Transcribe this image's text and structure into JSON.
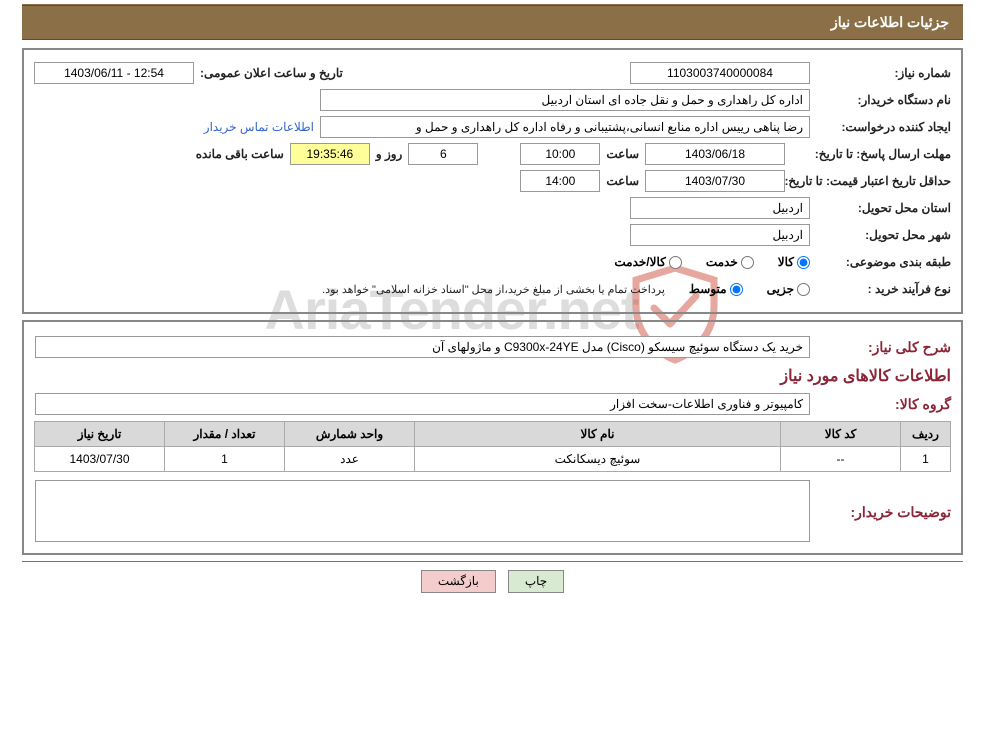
{
  "title": "جزئیات اطلاعات نیاز",
  "watermark": "AriaTender.net",
  "panel1": {
    "req_no_label": "شماره نیاز:",
    "req_no": "1103003740000084",
    "announce_label": "تاریخ و ساعت اعلان عمومی:",
    "announce_value": "12:54 - 1403/06/11",
    "buyer_org_label": "نام دستگاه خریدار:",
    "buyer_org": "اداره کل راهداری و حمل و نقل جاده ای استان اردبیل",
    "requester_label": "ایجاد کننده درخواست:",
    "requester": "رضا پناهی رییس اداره منابع انسانی،پشتیبانی و رفاه اداره کل راهداری و حمل و",
    "buyer_contact_link": "اطلاعات تماس خریدار",
    "deadline_label": "مهلت ارسال پاسخ:    تا تاریخ:",
    "deadline_date": "1403/06/18",
    "time_label": "ساعت",
    "deadline_time": "10:00",
    "days_value": "6",
    "days_and": "روز و",
    "countdown": "19:35:46",
    "remaining_label": "ساعت باقی مانده",
    "validity_label": "حداقل تاریخ اعتبار قیمت: تا تاریخ:",
    "validity_date": "1403/07/30",
    "validity_time": "14:00",
    "province_label": "استان محل تحویل:",
    "province": "اردبیل",
    "city_label": "شهر محل تحویل:",
    "city": "اردبیل",
    "category_label": "طبقه بندی موضوعی:",
    "cat_goods": "کالا",
    "cat_service": "خدمت",
    "cat_goods_service": "کالا/خدمت",
    "process_label": "نوع فرآیند خرید :",
    "process_partial": "جزیی",
    "process_medium": "متوسط",
    "process_note": "پرداخت تمام یا بخشی از مبلغ خرید،از محل \"اسناد خزانه اسلامی\" خواهد بود."
  },
  "panel2": {
    "desc_label": "شرح کلی نیاز:",
    "desc_value": "خرید یک دستگاه سوئیچ سیسکو (Cisco) مدل C9300x-24YE و ماژولهای آن",
    "items_title": "اطلاعات کالاهای مورد نیاز",
    "group_label": "گروه کالا:",
    "group_value": "کامپیوتر و فناوری اطلاعات-سخت افزار",
    "table": {
      "headers": [
        "ردیف",
        "کد کالا",
        "نام کالا",
        "واحد شمارش",
        "تعداد / مقدار",
        "تاریخ نیاز"
      ],
      "rows": [
        {
          "idx": "1",
          "code": "--",
          "name": "سوئیچ دیسکانکت",
          "unit": "عدد",
          "qty": "1",
          "date": "1403/07/30"
        }
      ]
    },
    "buyer_notes_label": "توضیحات خریدار:",
    "buyer_notes_value": ""
  },
  "buttons": {
    "print": "چاپ",
    "back": "بازگشت"
  }
}
